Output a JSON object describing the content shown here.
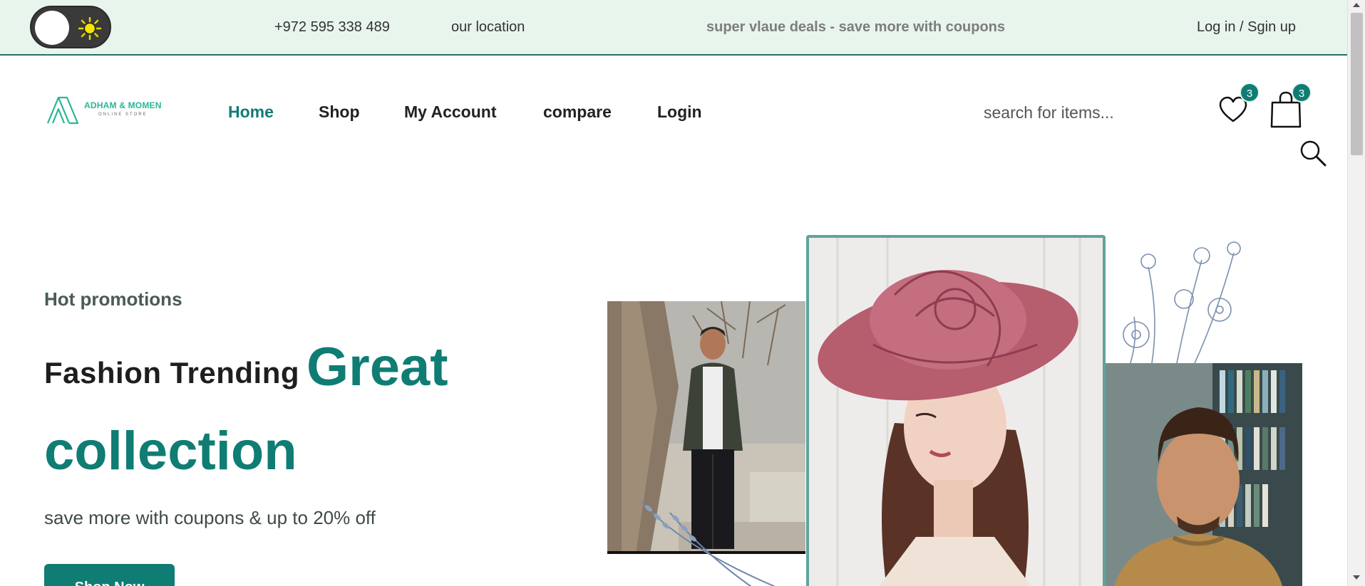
{
  "topbar": {
    "phone": "+972 595 338 489",
    "location": "our location",
    "deals": "super vlaue deals - save more with coupons",
    "auth": "Log in / Sgin up",
    "theme_toggle_icon": "sun-icon"
  },
  "header": {
    "logo_name": "ADHAM & MOMEN",
    "logo_tagline": "ONLINE STORE",
    "nav": {
      "home": "Home",
      "shop": "Shop",
      "account": "My Account",
      "compare": "compare",
      "login": "Login"
    },
    "search_placeholder": "search for items...",
    "wishlist_count": "3",
    "cart_count": "3"
  },
  "hero": {
    "promo": "Hot promotions",
    "title_part1": "Fashion Trending",
    "title_part2": "Great",
    "title_part3": "collection",
    "subtitle": "save more with coupons & up to 20% off",
    "button": "Shop Now"
  },
  "colors": {
    "accent": "#0f7d73",
    "topbar_bg": "#e8f5ec",
    "logo_green": "#2bb596"
  }
}
